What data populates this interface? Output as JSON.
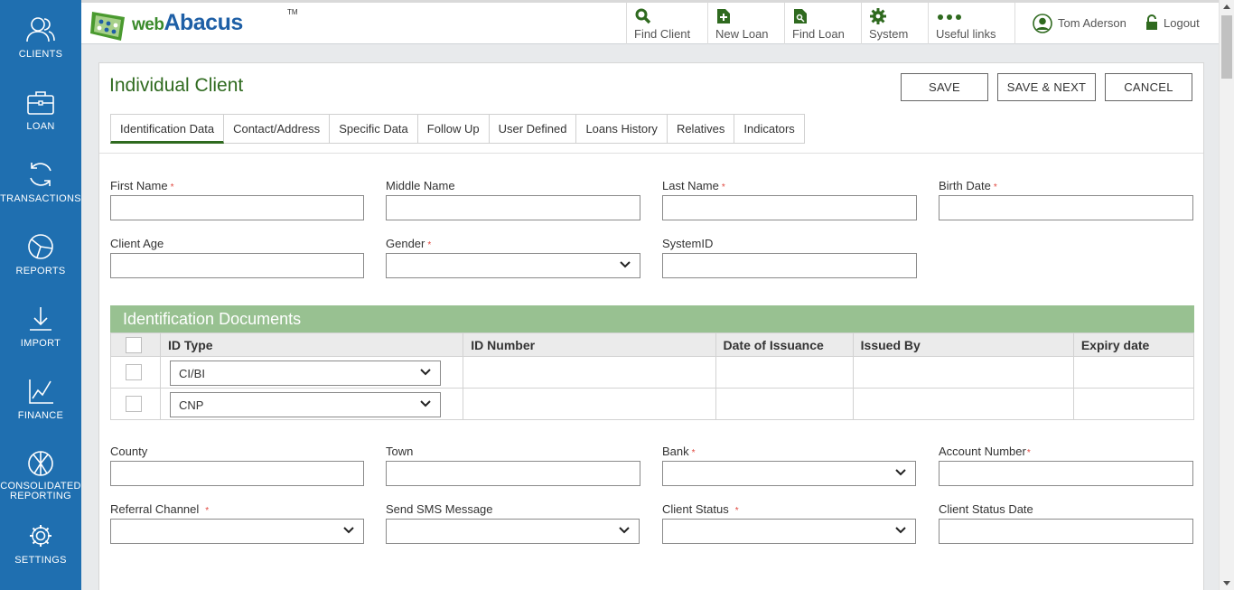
{
  "sidebar": {
    "items": [
      {
        "label": "CLIENTS",
        "icon": "users-icon"
      },
      {
        "label": "LOAN",
        "icon": "briefcase-icon"
      },
      {
        "label": "TRANSACTIONS",
        "icon": "refresh-icon"
      },
      {
        "label": "REPORTS",
        "icon": "pie-chart-icon"
      },
      {
        "label": "IMPORT",
        "icon": "download-icon"
      },
      {
        "label": "FINANCE",
        "icon": "line-chart-icon"
      },
      {
        "label_line1": "CONSOLIDATED",
        "label_line2": "REPORTING",
        "icon": "consolidated-icon"
      },
      {
        "label": "SETTINGS",
        "icon": "gear-icon"
      }
    ]
  },
  "header": {
    "logo": {
      "web": "web",
      "abacus": "Abacus",
      "tm": "TM"
    },
    "nav": [
      {
        "label": "Find Client",
        "icon": "search-icon"
      },
      {
        "label": "New Loan",
        "icon": "new-document-icon"
      },
      {
        "label": "Find Loan",
        "icon": "find-document-icon"
      },
      {
        "label": "System",
        "icon": "gear-icon"
      },
      {
        "label": "Useful links",
        "icon": "dots-icon"
      }
    ],
    "user_name": "Tom Aderson",
    "logout_label": "Logout"
  },
  "page": {
    "title": "Individual Client",
    "buttons": {
      "save": "SAVE",
      "save_next": "SAVE & NEXT",
      "cancel": "CANCEL"
    },
    "tabs": [
      "Identification Data",
      "Contact/Address",
      "Specific Data",
      "Follow Up",
      "User Defined",
      "Loans History",
      "Relatives",
      "Indicators"
    ],
    "active_tab": "Identification Data"
  },
  "form": {
    "first_name": {
      "label": "First Name",
      "required_mark": "*",
      "value": ""
    },
    "middle_name": {
      "label": "Middle Name",
      "value": ""
    },
    "last_name": {
      "label": "Last Name",
      "required_mark": "*",
      "value": ""
    },
    "birth_date": {
      "label": "Birth Date",
      "required_mark": "*",
      "value": ""
    },
    "client_age": {
      "label": "Client Age",
      "value": ""
    },
    "gender": {
      "label": "Gender",
      "required_mark": "*",
      "value": ""
    },
    "system_id": {
      "label": "SystemID",
      "value": ""
    },
    "county": {
      "label": "County",
      "value": ""
    },
    "town": {
      "label": "Town",
      "value": ""
    },
    "bank": {
      "label": "Bank",
      "required_mark": "*",
      "value": ""
    },
    "account_number": {
      "label": "Account Number",
      "required_mark": "*",
      "value": ""
    },
    "referral_channel": {
      "label": "Referral Channel",
      "required_mark": "*",
      "value": ""
    },
    "send_sms": {
      "label": "Send SMS Message",
      "value": ""
    },
    "client_status": {
      "label": "Client Status",
      "required_mark": "*",
      "value": ""
    },
    "client_status_date": {
      "label": "Client Status Date",
      "value": ""
    }
  },
  "id_documents": {
    "title": "Identification Documents",
    "columns": [
      "ID Type",
      "ID Number",
      "Date of Issuance",
      "Issued By",
      "Expiry date"
    ],
    "rows": [
      {
        "id_type": "CI/BI",
        "id_number": "",
        "date_of_issuance": "",
        "issued_by": "",
        "expiry_date": ""
      },
      {
        "id_type": "CNP",
        "id_number": "",
        "date_of_issuance": "",
        "issued_by": "",
        "expiry_date": ""
      }
    ]
  },
  "colors": {
    "sidebar": "#1f6fb0",
    "accent_green": "#2f6a1f",
    "section_header": "#98c191",
    "required": "#e1473e"
  }
}
